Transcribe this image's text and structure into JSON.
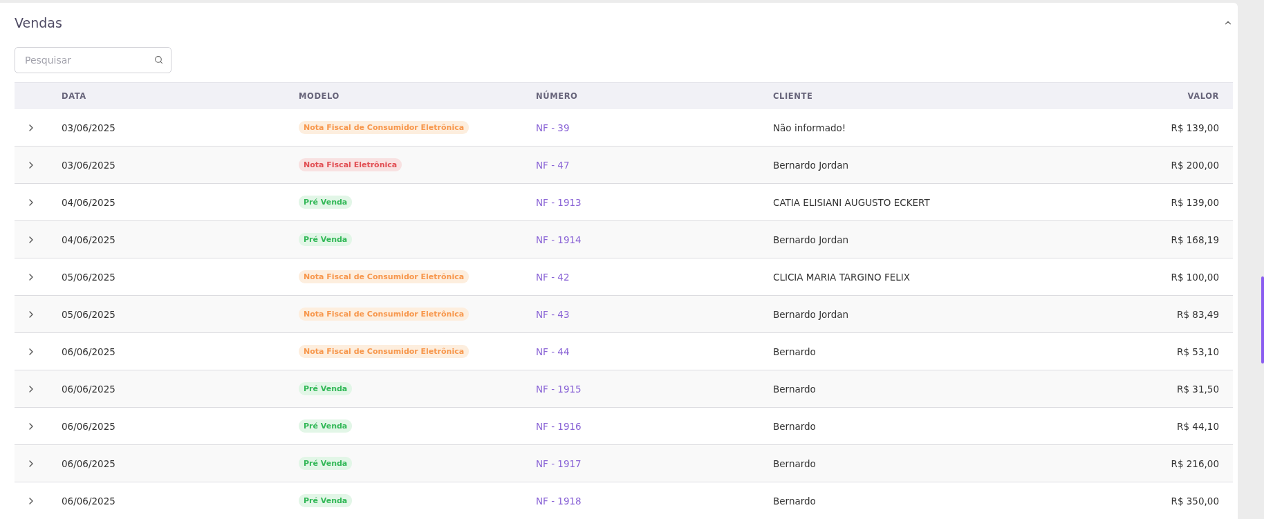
{
  "panel": {
    "title": "Vendas",
    "expanded": true
  },
  "search": {
    "placeholder": "Pesquisar"
  },
  "table": {
    "columns": [
      "DATA",
      "MODELO",
      "NÚMERO",
      "CLIENTE",
      "VALOR"
    ],
    "rows": [
      {
        "date": "03/06/2025",
        "model": {
          "label": "Nota Fiscal de Consumidor Eletrônica",
          "kind": "nfce"
        },
        "number": "NF - 39",
        "client": "Não informado!",
        "value": "R$ 139,00"
      },
      {
        "date": "03/06/2025",
        "model": {
          "label": "Nota Fiscal Eletrônica",
          "kind": "nfe"
        },
        "number": "NF - 47",
        "client": "Bernardo Jordan",
        "value": "R$ 200,00"
      },
      {
        "date": "04/06/2025",
        "model": {
          "label": "Pré Venda",
          "kind": "prevenda"
        },
        "number": "NF - 1913",
        "client": "CATIA ELISIANI AUGUSTO ECKERT",
        "value": "R$ 139,00"
      },
      {
        "date": "04/06/2025",
        "model": {
          "label": "Pré Venda",
          "kind": "prevenda"
        },
        "number": "NF - 1914",
        "client": "Bernardo Jordan",
        "value": "R$ 168,19"
      },
      {
        "date": "05/06/2025",
        "model": {
          "label": "Nota Fiscal de Consumidor Eletrônica",
          "kind": "nfce"
        },
        "number": "NF - 42",
        "client": "CLICIA MARIA TARGINO FELIX",
        "value": "R$ 100,00"
      },
      {
        "date": "05/06/2025",
        "model": {
          "label": "Nota Fiscal de Consumidor Eletrônica",
          "kind": "nfce"
        },
        "number": "NF - 43",
        "client": "Bernardo Jordan",
        "value": "R$ 83,49"
      },
      {
        "date": "06/06/2025",
        "model": {
          "label": "Nota Fiscal de Consumidor Eletrônica",
          "kind": "nfce"
        },
        "number": "NF - 44",
        "client": "Bernardo",
        "value": "R$ 53,10"
      },
      {
        "date": "06/06/2025",
        "model": {
          "label": "Pré Venda",
          "kind": "prevenda"
        },
        "number": "NF - 1915",
        "client": "Bernardo",
        "value": "R$ 31,50"
      },
      {
        "date": "06/06/2025",
        "model": {
          "label": "Pré Venda",
          "kind": "prevenda"
        },
        "number": "NF - 1916",
        "client": "Bernardo",
        "value": "R$ 44,10"
      },
      {
        "date": "06/06/2025",
        "model": {
          "label": "Pré Venda",
          "kind": "prevenda"
        },
        "number": "NF - 1917",
        "client": "Bernardo",
        "value": "R$ 216,00"
      },
      {
        "date": "06/06/2025",
        "model": {
          "label": "Pré Venda",
          "kind": "prevenda"
        },
        "number": "NF - 1918",
        "client": "Bernardo",
        "value": "R$ 350,00"
      }
    ]
  }
}
